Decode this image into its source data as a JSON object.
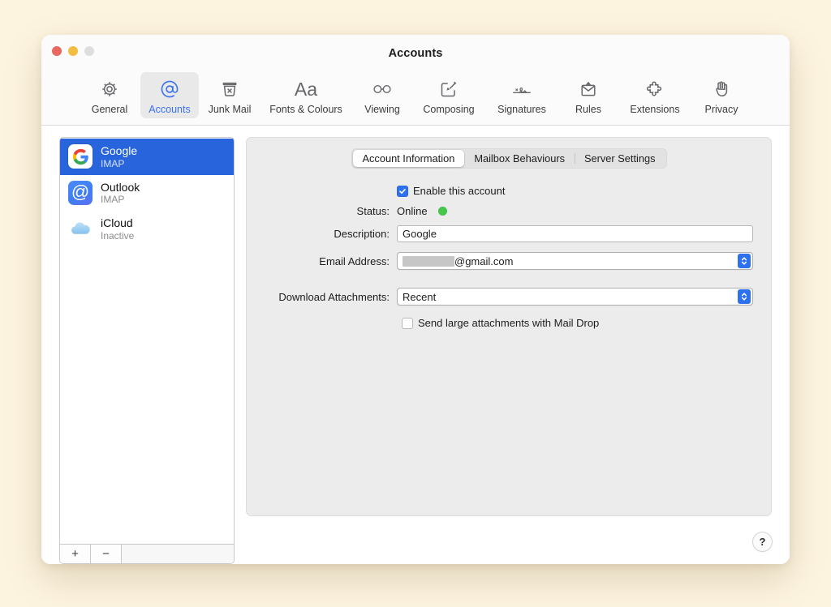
{
  "window": {
    "title": "Accounts",
    "traffic_lights": [
      "close",
      "minimise",
      "zoom-disabled"
    ]
  },
  "toolbar": {
    "items": [
      {
        "label": "General",
        "icon": "gear-icon",
        "selected": false
      },
      {
        "label": "Accounts",
        "icon": "at-sign-icon",
        "selected": true
      },
      {
        "label": "Junk Mail",
        "icon": "trash-x-icon",
        "selected": false
      },
      {
        "label": "Fonts & Colours",
        "icon": "aa-text-icon",
        "selected": false
      },
      {
        "label": "Viewing",
        "icon": "glasses-icon",
        "selected": false
      },
      {
        "label": "Composing",
        "icon": "compose-icon",
        "selected": false
      },
      {
        "label": "Signatures",
        "icon": "signature-icon",
        "selected": false
      },
      {
        "label": "Rules",
        "icon": "envelope-rules-icon",
        "selected": false
      },
      {
        "label": "Extensions",
        "icon": "puzzle-icon",
        "selected": false
      },
      {
        "label": "Privacy",
        "icon": "hand-icon",
        "selected": false
      }
    ]
  },
  "sidebar": {
    "accounts": [
      {
        "name": "Google",
        "type": "IMAP",
        "icon": "google-logo-icon",
        "selected": true
      },
      {
        "name": "Outlook",
        "type": "IMAP",
        "icon": "outlook-logo-icon",
        "selected": false
      },
      {
        "name": "iCloud",
        "type": "Inactive",
        "icon": "icloud-logo-icon",
        "selected": false
      }
    ],
    "footer": {
      "add_label": "+",
      "remove_label": "−"
    }
  },
  "main": {
    "tabs": [
      {
        "label": "Account Information",
        "active": true
      },
      {
        "label": "Mailbox Behaviours",
        "active": false
      },
      {
        "label": "Server Settings",
        "active": false
      }
    ],
    "enable_account": {
      "label": "Enable this account",
      "checked": true
    },
    "status": {
      "label": "Status:",
      "value": "Online",
      "indicator_colour": "#45c74b"
    },
    "description": {
      "label": "Description:",
      "value": "Google"
    },
    "email_address": {
      "label": "Email Address:",
      "value_redacted": true,
      "domain": "@gmail.com"
    },
    "download_attachments": {
      "label": "Download Attachments:",
      "value": "Recent"
    },
    "mail_drop": {
      "label": "Send large attachments with Mail Drop",
      "checked": false
    }
  },
  "help_button": {
    "label": "?"
  }
}
